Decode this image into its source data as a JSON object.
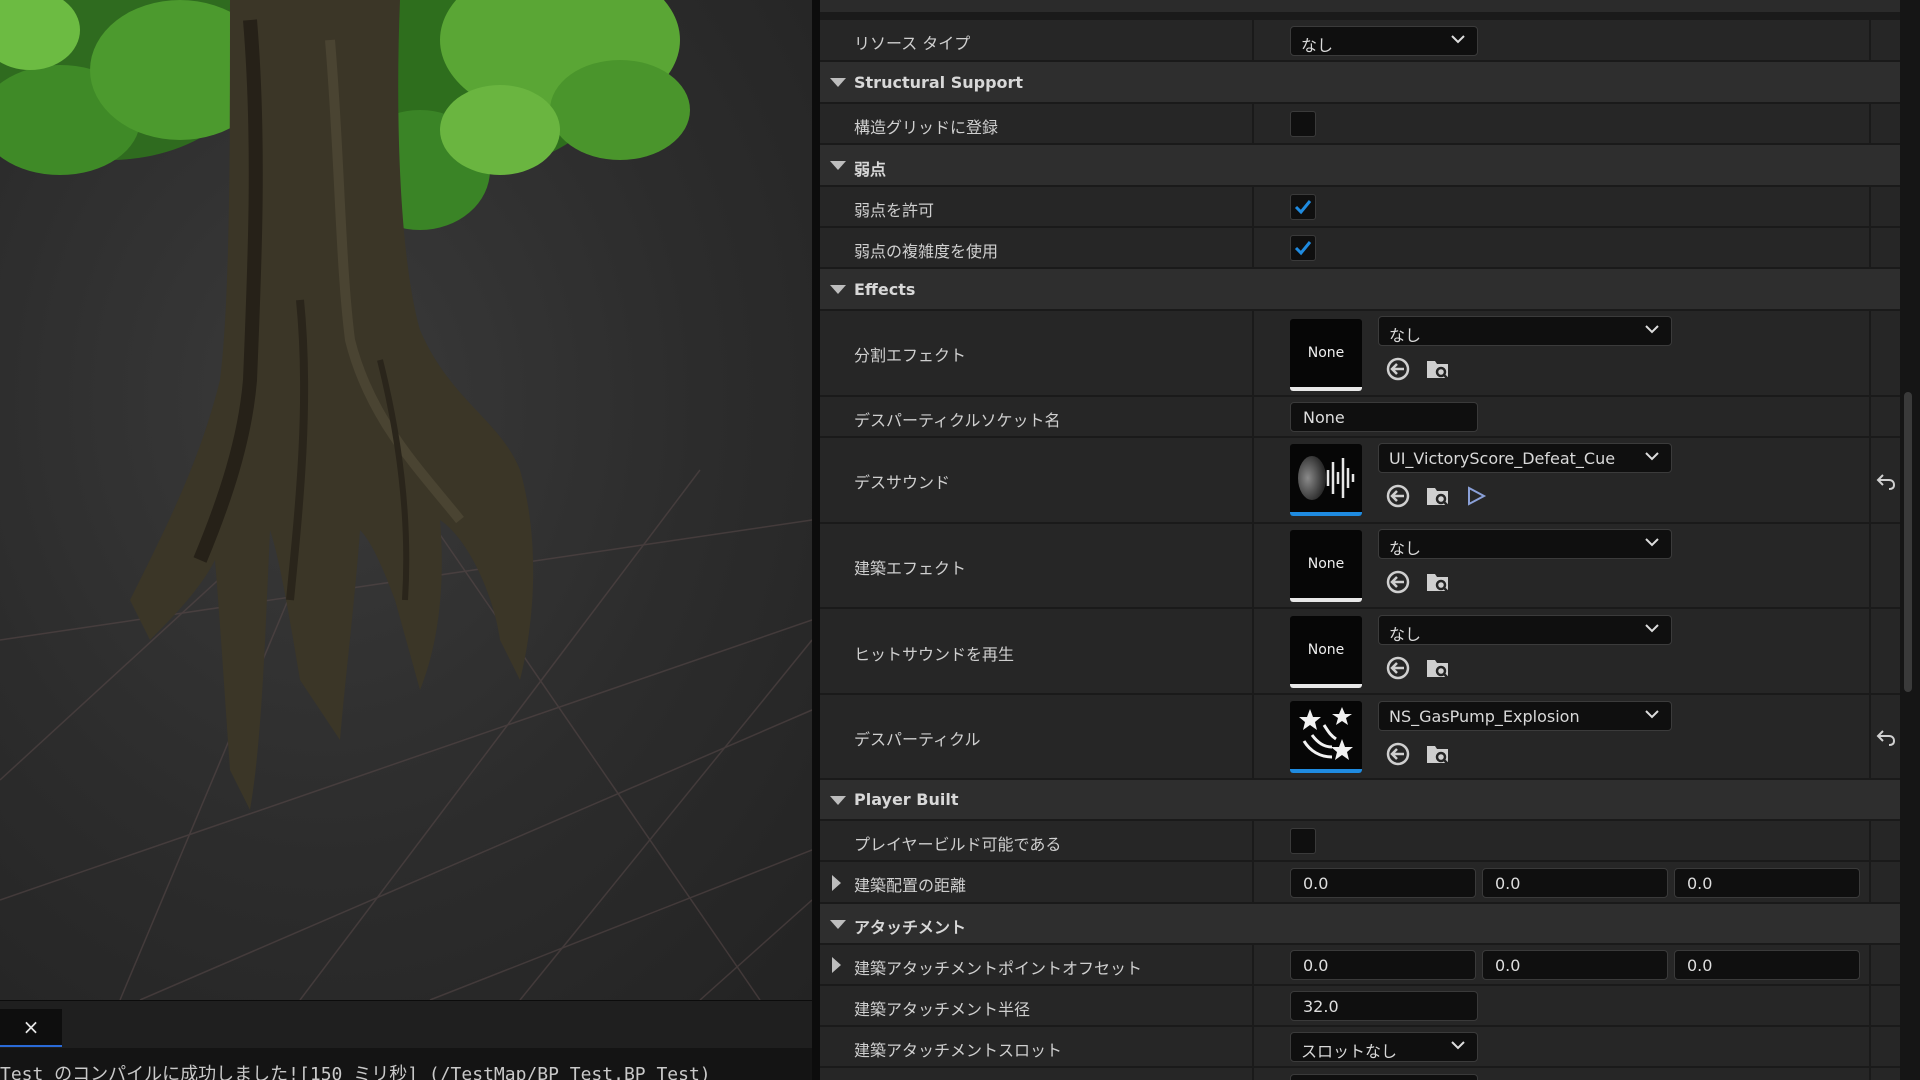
{
  "console": {
    "close_label": "×",
    "log_message": "Test のコンパイルに成功しました![150 ミリ秒] (/TestMap/BP_Test.BP_Test)"
  },
  "details": {
    "resource_type": {
      "label": "リソース タイプ",
      "value": "なし"
    },
    "structural_support": {
      "header": "Structural Support",
      "grid_register": {
        "label": "構造グリッドに登録",
        "checked": false
      }
    },
    "weakness": {
      "header": "弱点",
      "allow": {
        "label": "弱点を許可",
        "checked": true
      },
      "use_complexity": {
        "label": "弱点の複雑度を使用",
        "checked": true
      }
    },
    "effects": {
      "header": "Effects",
      "split_effect": {
        "label": "分割エフェクト",
        "thumb_text": "None",
        "value": "なし"
      },
      "death_particle_socket": {
        "label": "デスパーティクルソケット名",
        "value": "None"
      },
      "death_sound": {
        "label": "デスサウンド",
        "value": "UI_VictoryScore_Defeat_Cue",
        "thumb_icon": "sound-wave-icon"
      },
      "build_effect": {
        "label": "建築エフェクト",
        "thumb_text": "None",
        "value": "なし"
      },
      "hit_sound": {
        "label": "ヒットサウンドを再生",
        "thumb_text": "None",
        "value": "なし"
      },
      "death_particle": {
        "label": "デスパーティクル",
        "value": "NS_GasPump_Explosion",
        "thumb_icon": "particle-stars-icon"
      }
    },
    "player_built": {
      "header": "Player Built",
      "can_build": {
        "label": "プレイヤービルド可能である",
        "checked": false
      },
      "placement_distance": {
        "label": "建築配置の距離",
        "x": "0.0",
        "y": "0.0",
        "z": "0.0"
      }
    },
    "attachment": {
      "header": "アタッチメント",
      "point_offset": {
        "label": "建築アタッチメントポイントオフセット",
        "x": "0.0",
        "y": "0.0",
        "z": "0.0"
      },
      "radius": {
        "label": "建築アタッチメント半径",
        "value": "32.0"
      },
      "slot": {
        "label": "建築アタッチメントスロット",
        "value": "スロットなし"
      }
    }
  },
  "colors": {
    "accent_blue": "#1f8be0",
    "panel_bg": "#242424",
    "category_bg": "#2e2e2e"
  }
}
